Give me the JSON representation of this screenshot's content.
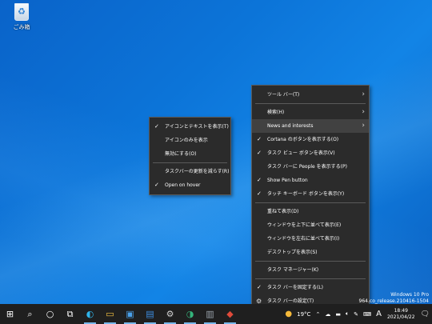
{
  "desktop": {
    "recycle_bin_label": "ごみ箱"
  },
  "main_menu": {
    "items": [
      {
        "label": "ツール バー(T)",
        "check": false,
        "arrow": true
      },
      {
        "sep": true
      },
      {
        "label": "検索(H)",
        "check": false,
        "arrow": true
      },
      {
        "label": "News and interests",
        "check": false,
        "arrow": true,
        "highlight": true
      },
      {
        "label": "Cortana のボタンを表示する(O)",
        "check": true,
        "arrow": false
      },
      {
        "label": "タスク ビュー ボタンを表示(V)",
        "check": true,
        "arrow": false
      },
      {
        "label": "タスク バーに People を表示する(P)",
        "check": false,
        "arrow": false
      },
      {
        "label": "Show Pen button",
        "check": true,
        "arrow": false
      },
      {
        "label": "タッチ キーボード ボタンを表示(Y)",
        "check": true,
        "arrow": false
      },
      {
        "sep": true
      },
      {
        "label": "重ねて表示(D)",
        "check": false,
        "arrow": false
      },
      {
        "label": "ウィンドウを上下に並べて表示(E)",
        "check": false,
        "arrow": false
      },
      {
        "label": "ウィンドウを左右に並べて表示(I)",
        "check": false,
        "arrow": false
      },
      {
        "label": "デスクトップを表示(S)",
        "check": false,
        "arrow": false
      },
      {
        "sep": true
      },
      {
        "label": "タスク マネージャー(K)",
        "check": false,
        "arrow": false
      },
      {
        "sep": true
      },
      {
        "label": "タスク バーを固定する(L)",
        "check": true,
        "arrow": false
      },
      {
        "label": "タスク バーの設定(T)",
        "check": false,
        "arrow": false,
        "gear": true
      }
    ]
  },
  "sub_menu": {
    "items": [
      {
        "label": "アイコンとテキストを表示(T)",
        "check": true
      },
      {
        "label": "アイコンのみを表示",
        "check": false
      },
      {
        "label": "無効にする(O)",
        "check": false
      },
      {
        "sep": true
      },
      {
        "label": "タスクバーの更新を減らす(R)",
        "check": false
      },
      {
        "label": "Open on hover",
        "check": true
      }
    ]
  },
  "watermark": {
    "line1": "Windows 10 Pro",
    "line2": "964.co_release.210416-1504"
  },
  "taskbar": {
    "weather": "19°C",
    "ime": "A",
    "time": "18:49",
    "date": "2021/04/22",
    "icons": [
      {
        "name": "start-icon",
        "glyph": "⊞",
        "color": "#ffffff"
      },
      {
        "name": "search-icon",
        "glyph": "⌕",
        "color": "#ffffff"
      },
      {
        "name": "cortana-icon",
        "glyph": "○",
        "color": "#ffffff"
      },
      {
        "name": "task-view-icon",
        "glyph": "⧉",
        "color": "#ffffff"
      },
      {
        "name": "edge-icon",
        "glyph": "◐",
        "color": "#2fb4ea"
      },
      {
        "name": "file-explorer-icon",
        "glyph": "▭",
        "color": "#f5c242"
      },
      {
        "name": "store-icon",
        "glyph": "▣",
        "color": "#4aa0e8"
      },
      {
        "name": "app-icon-blue",
        "glyph": "▤",
        "color": "#3d8ee0"
      },
      {
        "name": "settings-icon",
        "glyph": "⚙",
        "color": "#cfcfcf"
      },
      {
        "name": "edge-dev-icon",
        "glyph": "◑",
        "color": "#34b37a"
      },
      {
        "name": "app-icon-gray",
        "glyph": "▥",
        "color": "#9aa3ab"
      },
      {
        "name": "app-icon-red",
        "glyph": "◆",
        "color": "#e04a3a"
      }
    ]
  }
}
